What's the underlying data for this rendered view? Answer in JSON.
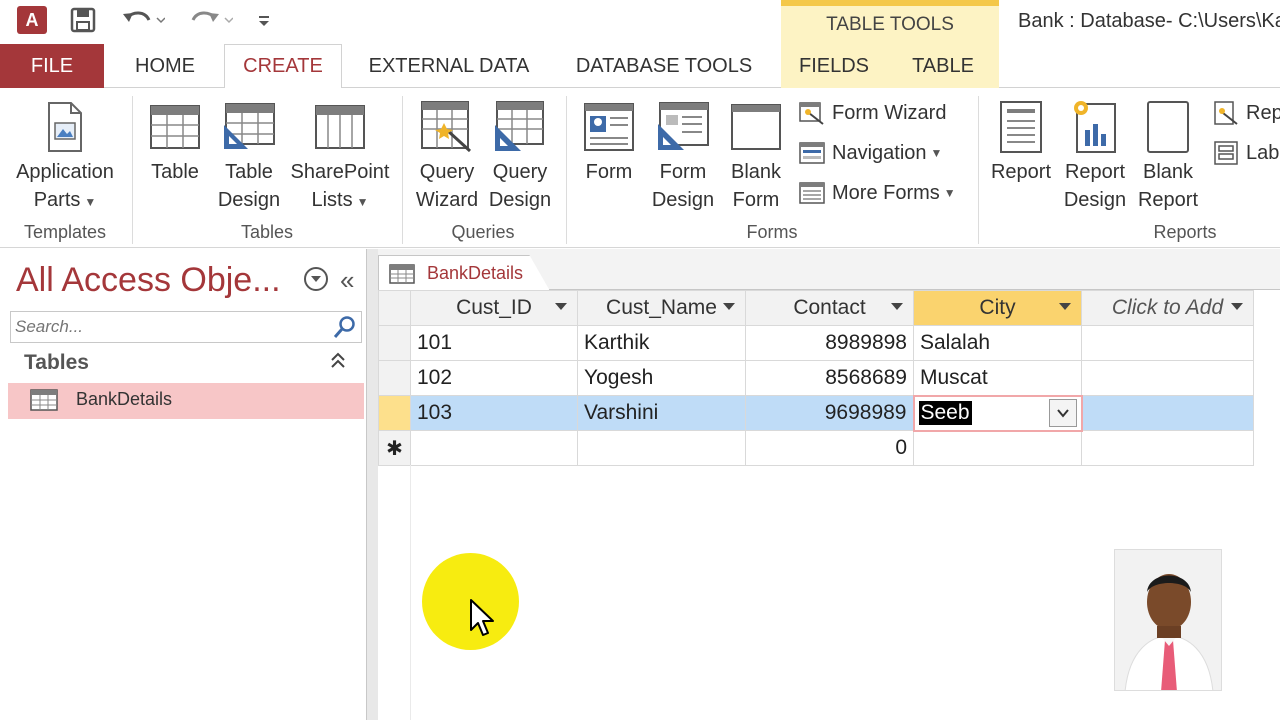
{
  "titlebar": {
    "app_icon": "A",
    "table_tools": "TABLE TOOLS",
    "window_title": "Bank : Database- C:\\Users\\Ka"
  },
  "tabs": {
    "file": "FILE",
    "home": "HOME",
    "create": "CREATE",
    "external_data": "EXTERNAL DATA",
    "database_tools": "DATABASE TOOLS",
    "fields": "FIELDS",
    "table": "TABLE"
  },
  "ribbon": {
    "templates": {
      "application_parts_line1": "Application",
      "application_parts_line2": "Parts",
      "group": "Templates"
    },
    "tables": {
      "table": "Table",
      "table_design_1": "Table",
      "table_design_2": "Design",
      "sharepoint_1": "SharePoint",
      "sharepoint_2": "Lists",
      "group": "Tables"
    },
    "queries": {
      "wizard_1": "Query",
      "wizard_2": "Wizard",
      "design_1": "Query",
      "design_2": "Design",
      "group": "Queries"
    },
    "forms": {
      "form": "Form",
      "form_design_1": "Form",
      "form_design_2": "Design",
      "blank_form_1": "Blank",
      "blank_form_2": "Form",
      "form_wizard": "Form Wizard",
      "navigation": "Navigation",
      "more_forms": "More Forms",
      "group": "Forms"
    },
    "reports": {
      "report": "Report",
      "report_design_1": "Report",
      "report_design_2": "Design",
      "blank_report_1": "Blank",
      "blank_report_2": "Report",
      "report_wizard": "Rep",
      "labels": "Labe",
      "group": "Reports"
    }
  },
  "nav": {
    "title": "All Access Obje...",
    "search_placeholder": "Search...",
    "section": "Tables",
    "items": [
      {
        "label": "BankDetails"
      }
    ]
  },
  "document": {
    "tab_label": "BankDetails",
    "columns": [
      "Cust_ID",
      "Cust_Name",
      "Contact",
      "City",
      "Click to Add"
    ],
    "rows": [
      {
        "id": "101",
        "name": "Karthik",
        "contact": "8989898",
        "city": "Salalah"
      },
      {
        "id": "102",
        "name": "Yogesh",
        "contact": "8568689",
        "city": "Muscat"
      },
      {
        "id": "103",
        "name": "Varshini",
        "contact": "9698989",
        "city": "Seeb"
      }
    ],
    "new_row": {
      "marker": "✱",
      "contact": "0"
    }
  },
  "colors": {
    "access_red": "#a4373a",
    "table_tools_yellow": "#fdf3c4",
    "selected_row": "#bfdcf7",
    "highlight": "#f7ec10"
  }
}
